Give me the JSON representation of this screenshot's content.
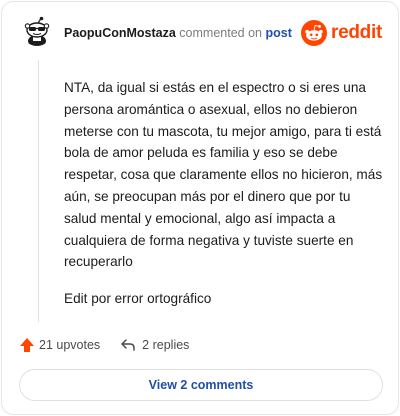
{
  "comment": {
    "username": "PaopuConMostaza",
    "action_text": "commented on",
    "target_text": "post",
    "paragraphs": [
      "NTA, da igual si estás en el espectro o si eres una persona aromántica o asexual, ellos no debieron meterse con tu mascota, tu mejor amigo, para ti está bola de amor peluda es familia y eso se debe respetar, cosa que claramente ellos no hicieron, más aún, se preocupan más por el dinero que por tu salud mental y emocional, algo así impacta a cualquiera de forma negativa y tuviste suerte en recuperarlo",
      "Edit por error ortográfico"
    ],
    "upvotes_label": "21 upvotes",
    "replies_label": "2 replies",
    "view_comments_label": "View 2 comments"
  },
  "brand": {
    "name": "reddit",
    "color": "#ff4500"
  },
  "icons": {
    "upvote": "upvote-arrow-icon",
    "reply": "reply-arrow-icon",
    "avatar": "snoo-avatar-icon",
    "logo": "reddit-snoo-logo-icon"
  }
}
